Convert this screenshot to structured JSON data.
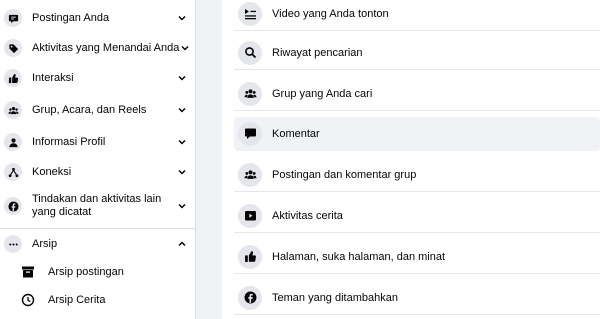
{
  "sidebar": {
    "items": [
      {
        "label": "Postingan Anda",
        "icon": "speech-bubble-icon"
      },
      {
        "label": "Aktivitas yang Menandai Anda",
        "icon": "tag-icon"
      },
      {
        "label": "Interaksi",
        "icon": "thumbs-up-icon"
      },
      {
        "label": "Grup, Acara, dan Reels",
        "icon": "people-icon"
      },
      {
        "label": "Informasi Profil",
        "icon": "person-icon"
      },
      {
        "label": "Koneksi",
        "icon": "connections-icon"
      },
      {
        "label": "Tindakan dan aktivitas lain yang dicatat",
        "icon": "facebook-icon"
      }
    ],
    "archive": {
      "label": "Arsip",
      "icon": "more-dots-icon",
      "children": [
        {
          "label": "Arsip postingan",
          "icon": "archive-box-icon"
        },
        {
          "label": "Arsip Cerita",
          "icon": "clock-history-icon"
        }
      ]
    }
  },
  "main": {
    "items": [
      {
        "label": "Video yang Anda tonton",
        "icon": "playlist-icon"
      },
      {
        "label": "Riwayat pencarian",
        "icon": "search-icon"
      },
      {
        "label": "Grup yang Anda cari",
        "icon": "people-icon"
      },
      {
        "label": "Komentar",
        "icon": "comment-icon",
        "selected": true
      },
      {
        "label": "Postingan dan komentar grup",
        "icon": "people-icon"
      },
      {
        "label": "Aktivitas cerita",
        "icon": "story-icon"
      },
      {
        "label": "Halaman, suka halaman, dan minat",
        "icon": "thumbs-up-icon"
      },
      {
        "label": "Teman yang ditambahkan",
        "icon": "facebook-icon"
      }
    ]
  }
}
